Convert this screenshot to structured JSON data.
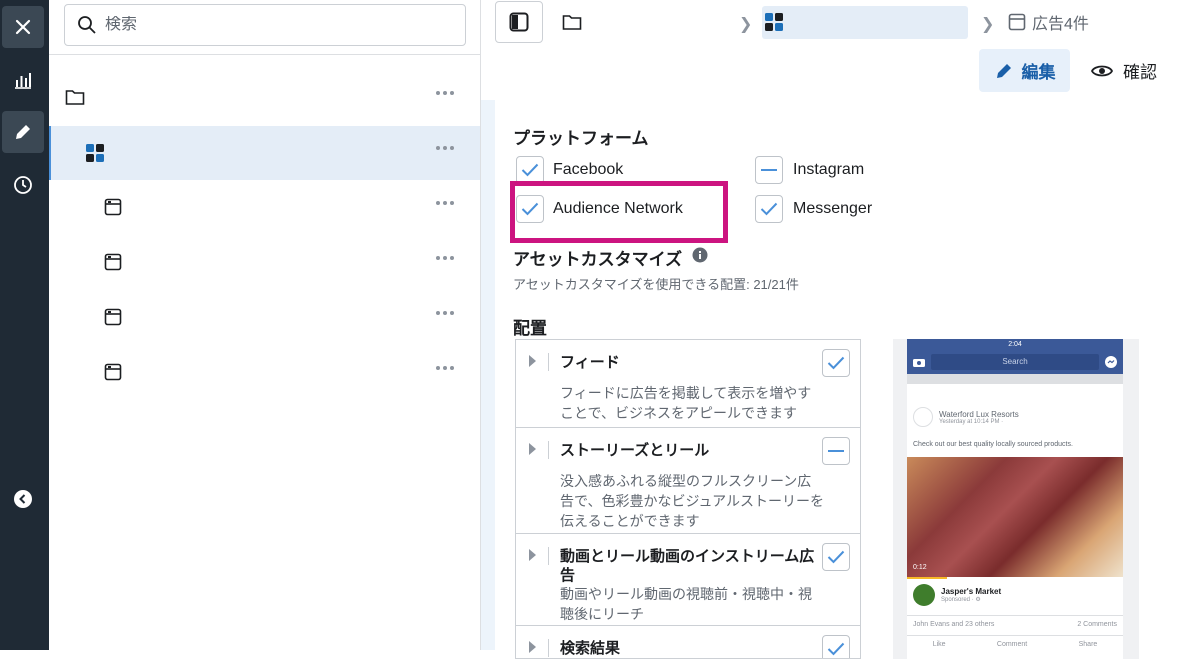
{
  "sidebar_rail": {
    "items": [
      {
        "name": "close-icon",
        "active": false
      },
      {
        "name": "chart-icon",
        "active": false
      },
      {
        "name": "pencil-icon",
        "active": true
      },
      {
        "name": "clock-icon",
        "active": false
      },
      {
        "name": "collapse-left-icon",
        "active": false
      }
    ]
  },
  "tree": {
    "search_placeholder": "検索",
    "rows": [
      {
        "icon": "folder-icon",
        "selected": false
      },
      {
        "icon": "adset-grid-icon",
        "selected": true
      },
      {
        "icon": "ad-icon",
        "selected": false
      },
      {
        "icon": "ad-icon",
        "selected": false
      },
      {
        "icon": "ad-icon",
        "selected": false
      },
      {
        "icon": "ad-icon",
        "selected": false
      }
    ]
  },
  "breadcrumb": {
    "ads_label": "広告4件"
  },
  "actions": {
    "edit_label": "編集",
    "review_label": "確認"
  },
  "platforms": {
    "heading": "プラットフォーム",
    "items": [
      {
        "label": "Facebook",
        "state": "checked"
      },
      {
        "label": "Instagram",
        "state": "partial"
      },
      {
        "label": "Audience Network",
        "state": "checked"
      },
      {
        "label": "Messenger",
        "state": "checked"
      }
    ]
  },
  "asset_custom": {
    "heading": "アセットカスタマイズ",
    "subtext": "アセットカスタマイズを使用できる配置: 21/21件"
  },
  "placements": {
    "heading": "配置",
    "items": [
      {
        "title": "フィード",
        "desc": "フィードに広告を掲載して表示を増やすことで、ビジネスをアピールできます",
        "state": "checked"
      },
      {
        "title": "ストーリーズとリール",
        "desc": "没入感あふれる縦型のフルスクリーン広告で、色彩豊かなビジュアルストーリーを伝えることができます",
        "state": "partial"
      },
      {
        "title": "動画とリール動画のインストリーム広告",
        "desc": "動画やリール動画の視聴前・視聴中・視聴後にリーチ",
        "state": "checked"
      },
      {
        "title": "検索結果",
        "desc": "",
        "state": "checked"
      }
    ]
  },
  "preview": {
    "time": "2:04",
    "search": "Search",
    "page_name": "Waterford Lux Resorts",
    "page_meta": "Yesterday at 10:14 PM ·",
    "post_text": "Check out our best quality locally sourced products.",
    "video_time": "0:12",
    "advertiser": "Jasper's Market",
    "sponsored": "Sponsored · ⚙",
    "reactions": "John Evans and 23 others",
    "comments": "2 Comments",
    "like": "Like",
    "comment": "Comment",
    "share": "Share",
    "colors": {
      "fb_blue": "#3b5998"
    }
  },
  "colors": {
    "rail_bg": "#1f2a35",
    "accent": "#4a90d9",
    "highlight": "#cc1480"
  }
}
